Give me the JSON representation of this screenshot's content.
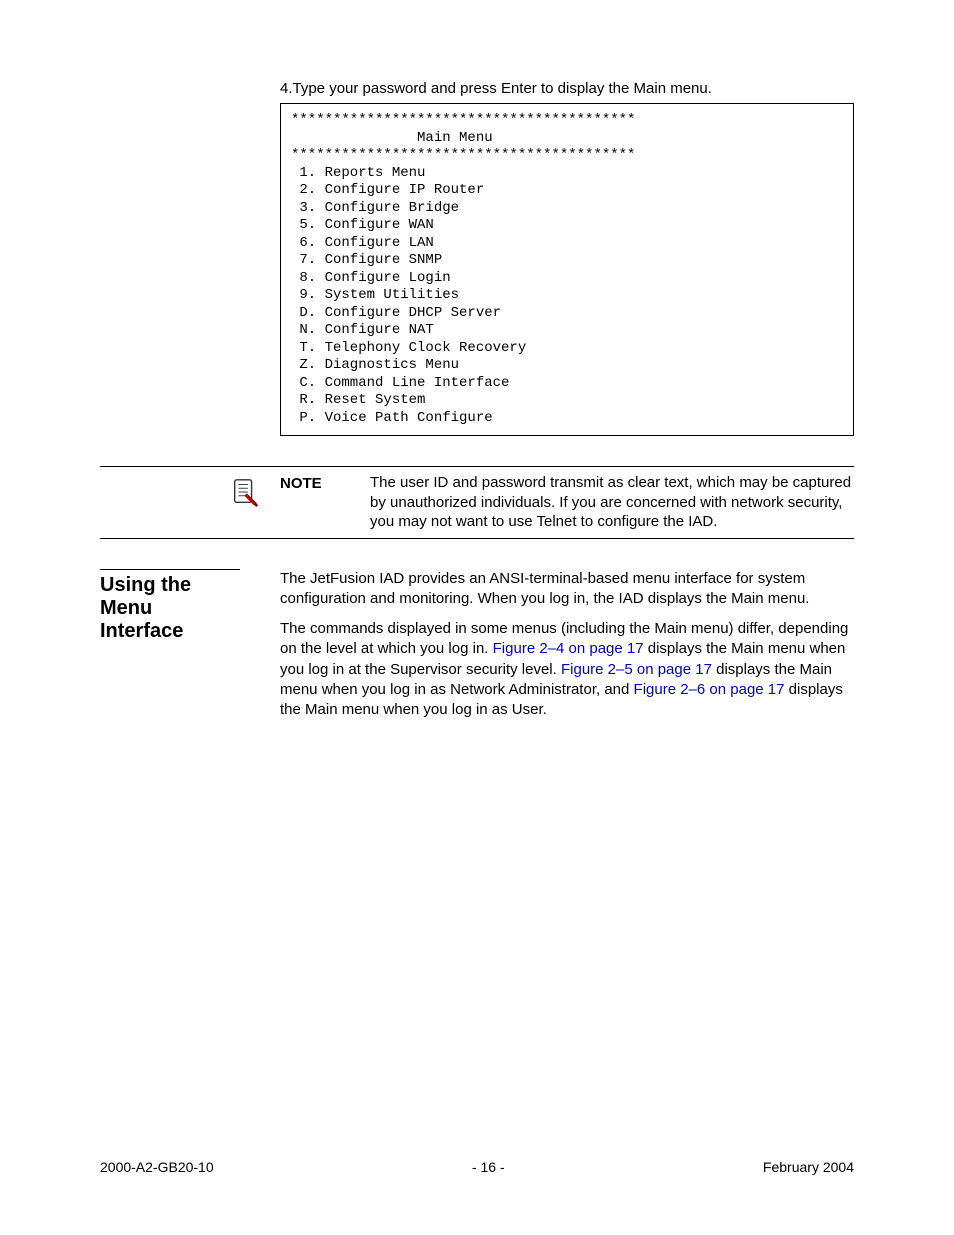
{
  "step": {
    "text": "4.Type your password and press Enter to display the Main menu."
  },
  "menu": {
    "rule": "*****************************************",
    "title": "               Main Menu",
    "items": [
      " 1. Reports Menu",
      " 2. Configure IP Router",
      " 3. Configure Bridge",
      " 5. Configure WAN",
      " 6. Configure LAN",
      " 7. Configure SNMP",
      " 8. Configure Login",
      " 9. System Utilities",
      " D. Configure DHCP Server",
      " N. Configure NAT",
      " T. Telephony Clock Recovery",
      " Z. Diagnostics Menu",
      " C. Command Line Interface",
      " R. Reset System",
      " P. Voice Path Configure"
    ]
  },
  "note": {
    "label": "NOTE",
    "text": "The user ID and password transmit as clear text, which may be captured by unauthorized individuals. If you are concerned with network security, you may not want to use Telnet to configure the IAD."
  },
  "section": {
    "heading": "Using the Menu Interface",
    "p1": "The JetFusion IAD provides an ANSI-terminal-based menu interface for system configuration and monitoring. When you log in, the IAD displays the Main menu.",
    "p2a": "The commands displayed in some menus (including the Main menu) differ, depending on the level at which you log in. ",
    "p2_xref1": "Figure 2–4 on page 17",
    "p2b": " displays the Main menu when you log in at the Supervisor security level. ",
    "p2_xref2": "Figure 2–5 on page 17",
    "p2c": " displays the Main menu when you log in as Network Administrator, and ",
    "p2_xref3": "Figure 2–6 on page 17",
    "p2d": " displays the Main menu when you log in as User."
  },
  "footer": {
    "left": "2000-A2-GB20-10",
    "center": "- 16 -",
    "right": "February 2004"
  }
}
